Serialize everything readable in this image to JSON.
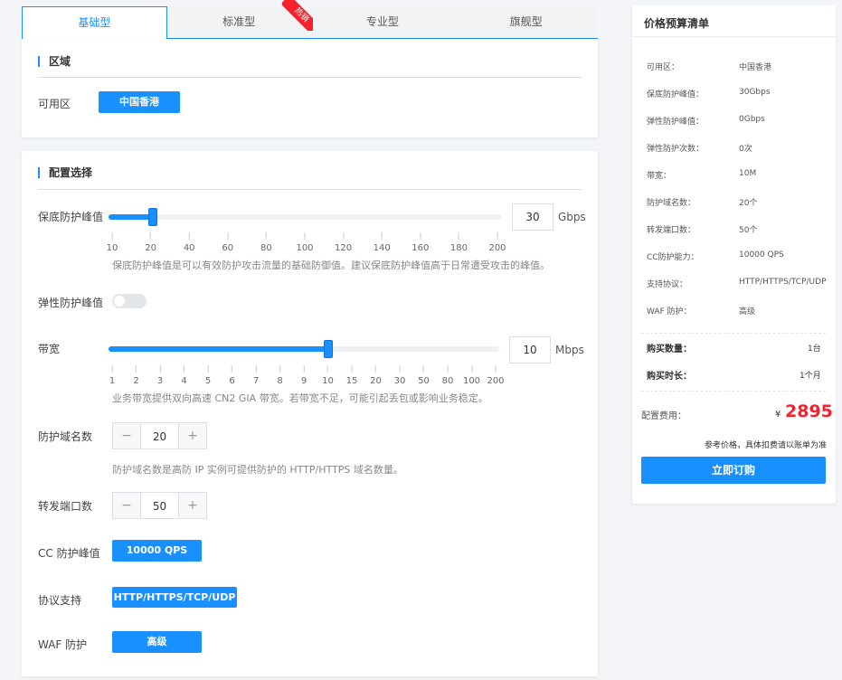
{
  "tabs": [
    {
      "label": "基础型",
      "active": true
    },
    {
      "label": "标准型",
      "active": false
    },
    {
      "label": "专业型",
      "active": false
    },
    {
      "label": "旗舰型",
      "active": false
    }
  ],
  "hot_badge": "热销",
  "region": {
    "title": "区域",
    "label": "可用区",
    "value": "中国香港"
  },
  "config": {
    "title": "配置选择",
    "base_protection": {
      "label": "保底防护峰值",
      "value": "30",
      "unit": "Gbps",
      "ticks": [
        "10",
        "20",
        "40",
        "60",
        "80",
        "100",
        "120",
        "140",
        "160",
        "180",
        "200"
      ],
      "hint": "保底防护峰值是可以有效防护攻击流量的基础防御值。建议保底防护峰值高于日常遭受攻击的峰值。"
    },
    "elastic_protection": {
      "label": "弹性防护峰值",
      "enabled": false
    },
    "bandwidth": {
      "label": "带宽",
      "value": "10",
      "unit": "Mbps",
      "ticks": [
        "1",
        "2",
        "3",
        "4",
        "5",
        "6",
        "7",
        "8",
        "9",
        "10",
        "15",
        "20",
        "30",
        "50",
        "80",
        "100",
        "200"
      ],
      "hint": "业务带宽提供双向高速 CN2 GIA 带宽。若带宽不足，可能引起丢包或影响业务稳定。"
    },
    "domains": {
      "label": "防护域名数",
      "value": "20",
      "minus": "−",
      "plus": "+",
      "hint": "防护域名数是高防 IP 实例可提供防护的 HTTP/HTTPS 域名数量。"
    },
    "ports": {
      "label": "转发端口数",
      "value": "50",
      "minus": "−",
      "plus": "+"
    },
    "cc": {
      "label": "CC 防护峰值",
      "value": "10000 QPS"
    },
    "protocol": {
      "label": "协议支持",
      "value": "HTTP/HTTPS/TCP/UDP"
    },
    "waf": {
      "label": "WAF 防护",
      "value": "高级"
    }
  },
  "summary": {
    "title": "价格预算清单",
    "rows": [
      {
        "label": "可用区：",
        "value": "中国香港"
      },
      {
        "label": "保底防护峰值：",
        "value": "30Gbps"
      },
      {
        "label": "弹性防护峰值：",
        "value": "0Gbps"
      },
      {
        "label": "弹性防护次数：",
        "value": "0次"
      },
      {
        "label": "带宽：",
        "value": "10M"
      },
      {
        "label": "防护域名数：",
        "value": "20个"
      },
      {
        "label": "转发端口数：",
        "value": "50个"
      },
      {
        "label": "CC防护能力：",
        "value": "10000 QPS"
      },
      {
        "label": "支持协议：",
        "value": "HTTP/HTTPS/TCP/UDP"
      },
      {
        "label": "WAF 防护：",
        "value": "高级"
      }
    ],
    "quantity_label": "购买数量：",
    "quantity_value": "1台",
    "duration_label": "购买时长：",
    "duration_value": "1个月",
    "fee_label": "配置费用：",
    "currency": "¥",
    "price": "2895",
    "note": "参考价格，具体扣费请以账单为准",
    "buy_label": "立即订购"
  },
  "colors": {
    "accent": "#1890ff",
    "price": "#f5222d",
    "hot": "#f5222d"
  }
}
